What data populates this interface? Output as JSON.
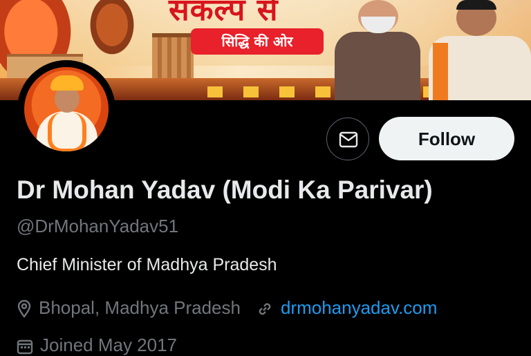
{
  "banner": {
    "headline": "संकल्प से",
    "subline": "सिद्धि की ओर"
  },
  "profile": {
    "name": "Dr Mohan Yadav (Modi Ka Parivar)",
    "handle": "@DrMohanYadav51",
    "bio": "Chief Minister of Madhya Pradesh",
    "location": "Bhopal, Madhya Pradesh",
    "website": "drmohanyadav.com",
    "joined": "Joined May 2017"
  },
  "actions": {
    "follow_label": "Follow"
  },
  "icons": {
    "message": "envelope-icon",
    "location": "map-pin-icon",
    "link": "link-icon",
    "calendar": "calendar-icon"
  },
  "colors": {
    "background": "#000000",
    "text_primary": "#e7e9ea",
    "text_secondary": "#71767b",
    "link": "#1d9bf0",
    "follow_bg": "#eff3f4"
  }
}
